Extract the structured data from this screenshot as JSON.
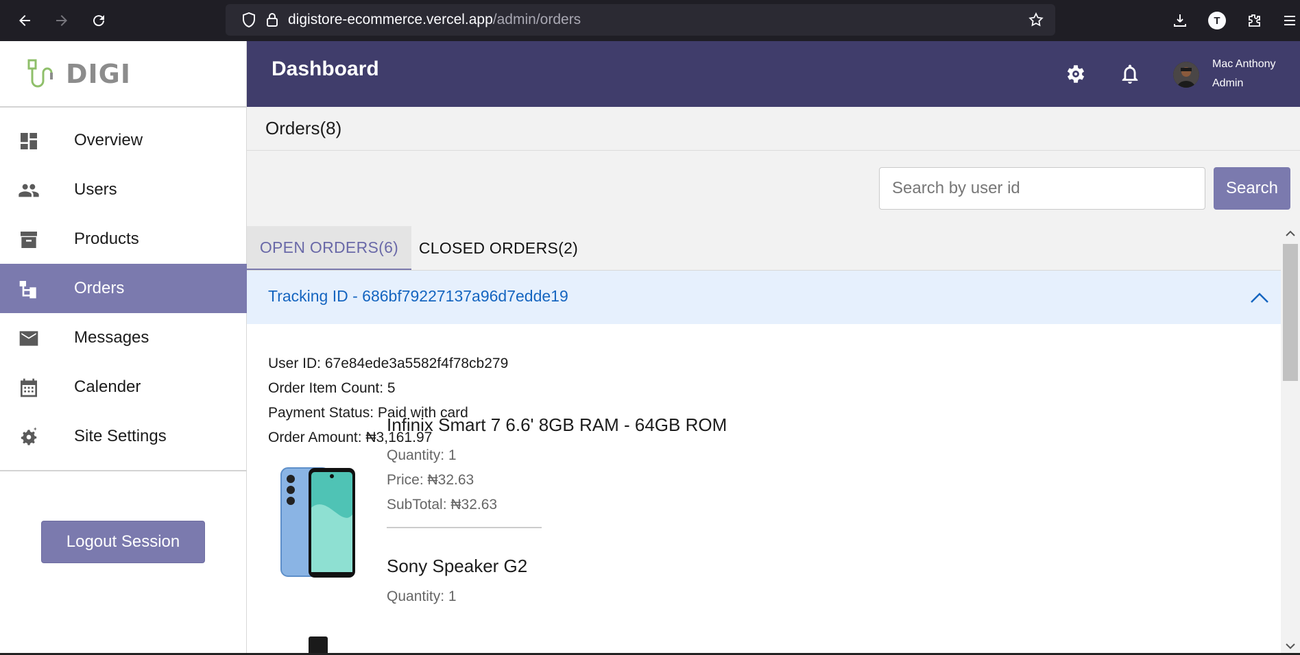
{
  "browser": {
    "url_host": "digistore-ecommerce.vercel.app",
    "url_path": "/admin/orders",
    "profile_initial": "T"
  },
  "sidebar": {
    "logo_text": "DIGI",
    "items": [
      {
        "label": "Overview",
        "icon": "dashboard-icon"
      },
      {
        "label": "Users",
        "icon": "users-icon"
      },
      {
        "label": "Products",
        "icon": "archive-icon"
      },
      {
        "label": "Orders",
        "icon": "orders-tree-icon",
        "active": true
      },
      {
        "label": "Messages",
        "icon": "mail-icon"
      },
      {
        "label": "Calender",
        "icon": "calendar-icon"
      },
      {
        "label": "Site Settings",
        "icon": "settings-cog-icon"
      }
    ],
    "logout_label": "Logout Session"
  },
  "header": {
    "title": "Dashboard",
    "user_name": "Mac Anthony",
    "user_role": "Admin"
  },
  "main": {
    "orders_title": "Orders(8)",
    "search_placeholder": "Search by user id",
    "search_label": "Search",
    "tabs": [
      {
        "label": "OPEN ORDERS(6)",
        "active": true
      },
      {
        "label": "CLOSED ORDERS(2)",
        "active": false
      }
    ],
    "order": {
      "tracking": "Tracking ID - 686bf79227137a96d7edde19",
      "user_id": "User ID: 67e84ede3a5582f4f78cb279",
      "item_count": "Order Item Count: 5",
      "payment_status": "Payment Status: Paid with card",
      "amount": "Order Amount: ₦3,161.97",
      "items": [
        {
          "name": "Infinix Smart 7 6.6' 8GB RAM - 64GB ROM",
          "quantity": "Quantity: 1",
          "price": "Price: ₦32.63",
          "subtotal": "SubTotal: ₦32.63"
        },
        {
          "name": "Sony Speaker G2",
          "quantity": "Quantity: 1"
        }
      ]
    }
  },
  "colors": {
    "accent": "#7b7aae",
    "header_bg": "#403d6b",
    "tracking_link": "#1565c0",
    "accordion_bg": "#e6f0fd"
  }
}
